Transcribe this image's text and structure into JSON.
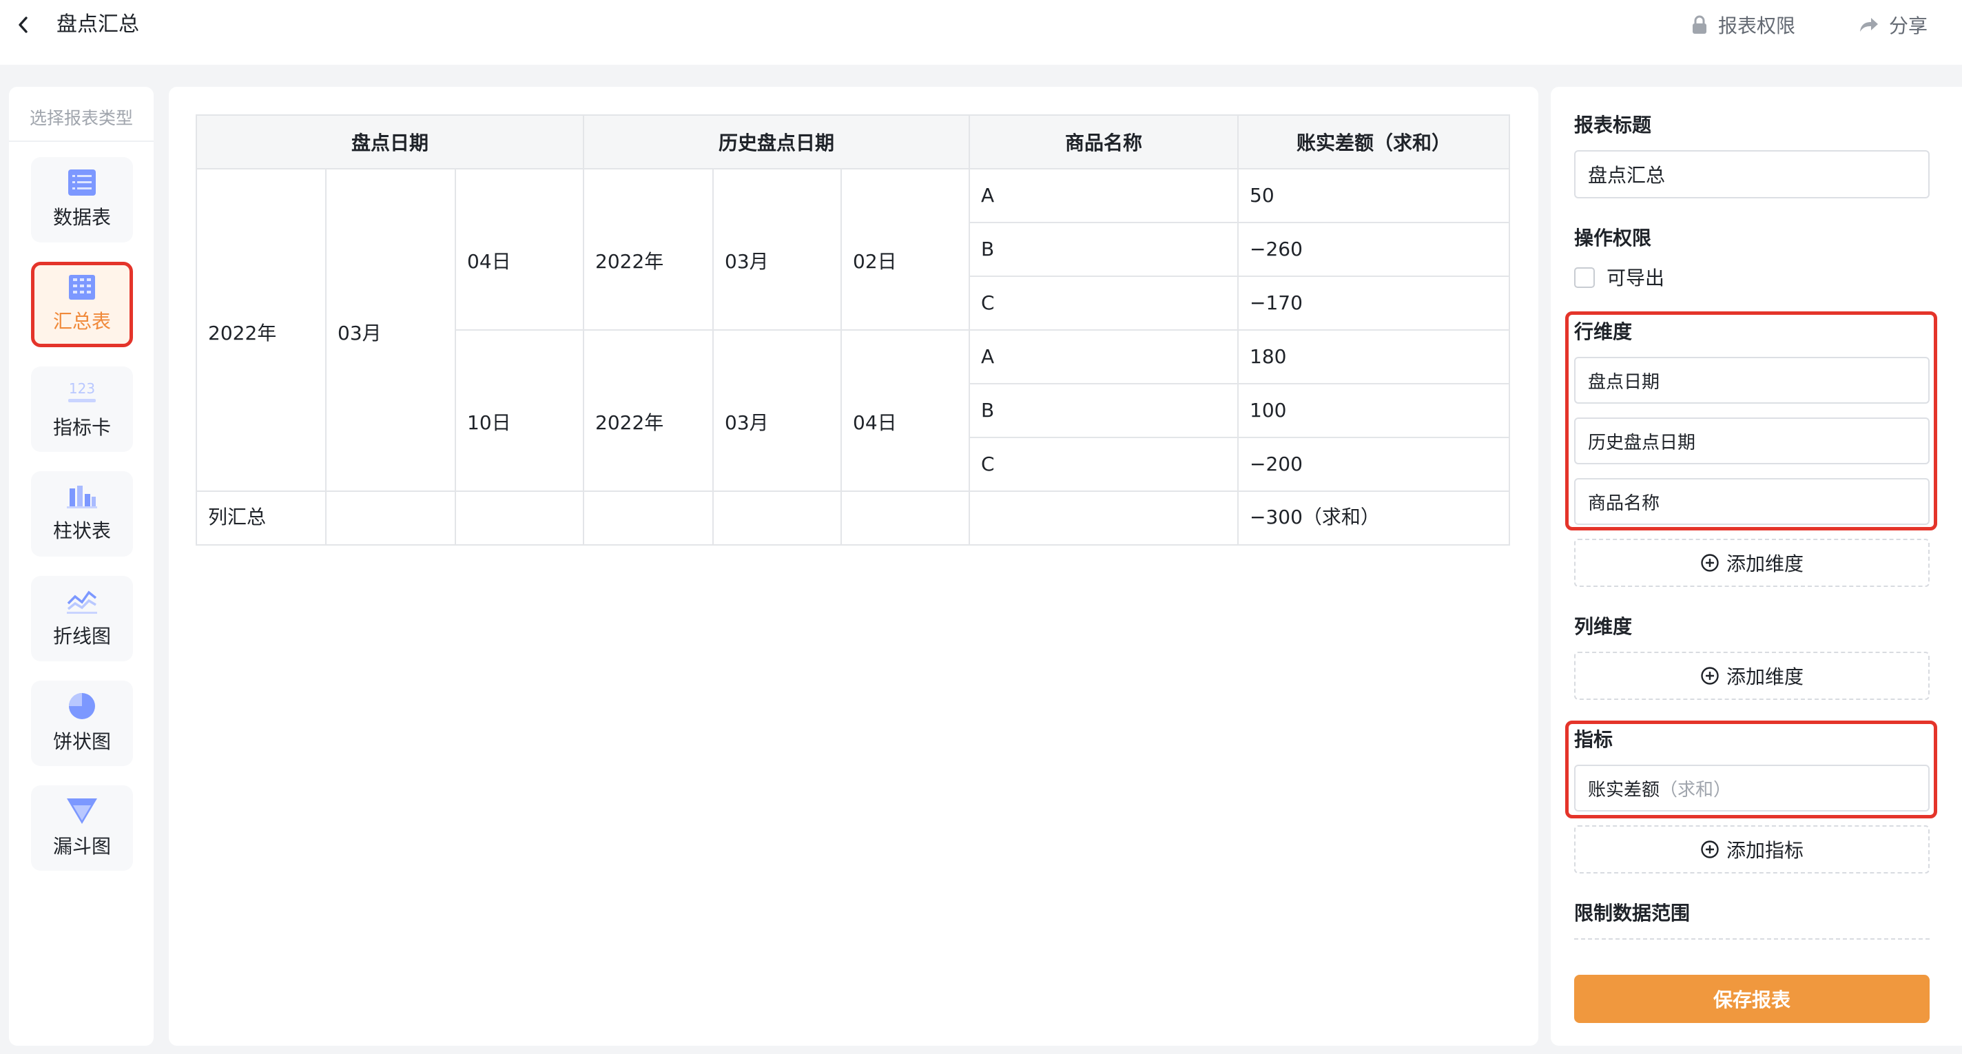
{
  "header": {
    "title": "盘点汇总",
    "permission_label": "报表权限",
    "share_label": "分享"
  },
  "sidebar": {
    "title": "选择报表类型",
    "items": [
      {
        "label": "数据表",
        "icon": "data-table-icon",
        "active": false
      },
      {
        "label": "汇总表",
        "icon": "summary-table-icon",
        "active": true
      },
      {
        "label": "指标卡",
        "icon": "metric-card-icon",
        "active": false
      },
      {
        "label": "柱状表",
        "icon": "bar-chart-icon",
        "active": false
      },
      {
        "label": "折线图",
        "icon": "line-chart-icon",
        "active": false
      },
      {
        "label": "饼状图",
        "icon": "pie-chart-icon",
        "active": false
      },
      {
        "label": "漏斗图",
        "icon": "funnel-chart-icon",
        "active": false
      }
    ]
  },
  "table": {
    "headers": [
      "盘点日期",
      "历史盘点日期",
      "商品名称",
      "账实差额（求和）"
    ],
    "year": "2022年",
    "month": "03月",
    "groups": [
      {
        "day": "04日",
        "hist_year": "2022年",
        "hist_month": "03月",
        "hist_day": "02日",
        "rows": [
          {
            "name": "A",
            "value": "50"
          },
          {
            "name": "B",
            "value": "−260"
          },
          {
            "name": "C",
            "value": "−170"
          }
        ]
      },
      {
        "day": "10日",
        "hist_year": "2022年",
        "hist_month": "03月",
        "hist_day": "04日",
        "rows": [
          {
            "name": "A",
            "value": "180"
          },
          {
            "name": "B",
            "value": "100"
          },
          {
            "name": "C",
            "value": "−200"
          }
        ]
      }
    ],
    "total_label": "列汇总",
    "total_value": "−300（求和）"
  },
  "settings": {
    "title_label": "报表标题",
    "title_value": "盘点汇总",
    "permission_label": "操作权限",
    "exportable_label": "可导出",
    "exportable_checked": false,
    "row_dim_label": "行维度",
    "row_dims": [
      "盘点日期",
      "历史盘点日期",
      "商品名称"
    ],
    "add_dim_label": "添加维度",
    "col_dim_label": "列维度",
    "metric_label": "指标",
    "metric_name": "账实差额",
    "metric_agg": "（求和）",
    "add_metric_label": "添加指标",
    "limit_label": "限制数据范围",
    "save_label": "保存报表"
  },
  "colors": {
    "accent": "#f0983e",
    "highlight_border": "#e4342a",
    "icon_blue": "#6b8cff",
    "active_text": "#f0893a"
  }
}
